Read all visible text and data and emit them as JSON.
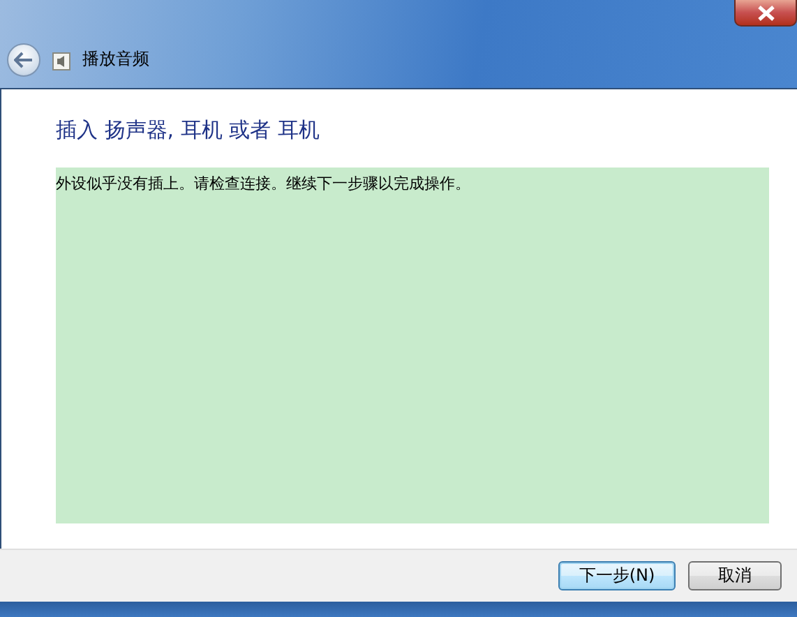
{
  "window": {
    "title": "播放音频"
  },
  "heading": "插入 扬声器, 耳机 或者 耳机",
  "message": "外设似乎没有插上。请检查连接。继续下一步骤以完成操作。",
  "buttons": [
    {
      "label": "下一步(N)",
      "kind": "default"
    },
    {
      "label": "取消",
      "kind": "normal"
    }
  ]
}
